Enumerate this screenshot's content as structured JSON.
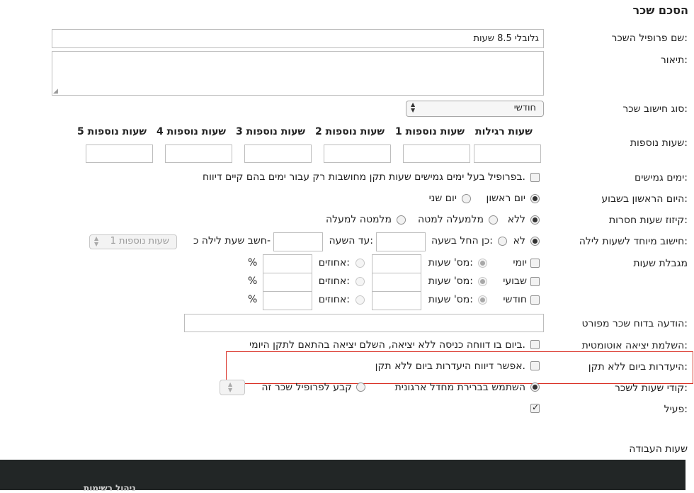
{
  "page": {
    "title": "הסכם שכר"
  },
  "fields": {
    "profile_name": {
      "label": "שם פרופיל השכר:",
      "value": "גלובלי 8.5 שעות"
    },
    "description": {
      "label": "תיאור:",
      "value": ""
    },
    "calc_type": {
      "label": "סוג חישוב שכר:",
      "value": "חודשי"
    },
    "overtime": {
      "label": "שעות נוספות:",
      "columns": [
        "שעות רגילות",
        "שעות נוספות 1",
        "שעות נוספות 2",
        "שעות נוספות 3",
        "שעות נוספות 4",
        "שעות נוספות 5"
      ]
    },
    "flex_days": {
      "label": "ימים גמישים:",
      "text": "בפרופיל בעל ימים גמישים שעות תקן מחושבות רק עבור ימים בהם קיים דיווח."
    },
    "first_day": {
      "label": "היום הראשון בשבוע:",
      "option1": "יום ראשון",
      "option2": "יום שני"
    },
    "missing_hours": {
      "label": "קיזוז שעות חסרות:",
      "option1": "ללא",
      "option2": "מלמעלה למטה",
      "option3": "מלמטה למעלה"
    },
    "night": {
      "label": "חישוב מיוחד לשעות לילה:",
      "no": "לא",
      "yes_from": "כן החל בשעה:",
      "until": "עד השעה:",
      "calc_as": "חשב שעת לילה כ-",
      "select_value": "שעות נוספות 1"
    },
    "limit": {
      "label": "מגבלת שעות",
      "rows": [
        {
          "period": "יומי",
          "hours": "מס' שעות:",
          "percent": "אחוזים:",
          "pct_sign": "%"
        },
        {
          "period": "שבועי",
          "hours": "מס' שעות:",
          "percent": "אחוזים:",
          "pct_sign": "%"
        },
        {
          "period": "חודשי",
          "hours": "מס' שעות:",
          "percent": "אחוזים:",
          "pct_sign": "%"
        }
      ]
    },
    "report_msg": {
      "label": "הודעה בדוח שכר מפורט:",
      "value": ""
    },
    "auto_exit": {
      "label": "השלמת יציאה אוטומטית:",
      "text": "ביום בו דווחה כניסה ללא יציאה, השלם יציאה בהתאם לתקן היומי."
    },
    "absence": {
      "label": "היעדרות ביום ללא תקן:",
      "text": "אפשר דיווח היעדרות ביום ללא תקן."
    },
    "codes": {
      "label": "קודי שעות לשכר:",
      "option1": "השתמש בברירת מחדל ארגונית",
      "option2": "קבע לפרופיל שכר זה"
    },
    "active": {
      "label": "פעיל:"
    }
  },
  "sections": {
    "work_hours": "שעות העבודה"
  },
  "footer": {
    "link": "ניהול רשימות"
  }
}
